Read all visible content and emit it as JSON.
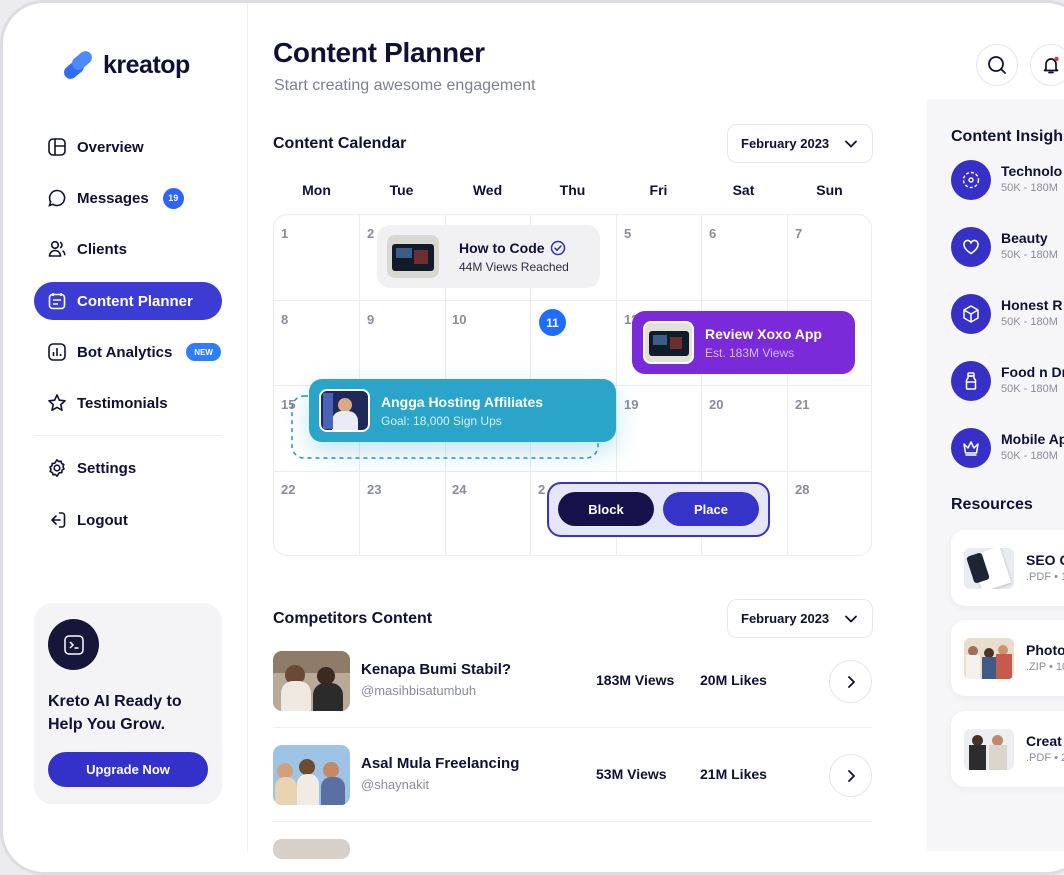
{
  "brand": {
    "name": "kreatop"
  },
  "sidebar": {
    "items": [
      {
        "label": "Overview",
        "icon": "layout-icon"
      },
      {
        "label": "Messages",
        "icon": "chat-icon",
        "badge": "19"
      },
      {
        "label": "Clients",
        "icon": "users-icon"
      },
      {
        "label": "Content Planner",
        "icon": "calendar-icon",
        "active": true
      },
      {
        "label": "Bot Analytics",
        "icon": "chart-icon",
        "badge": "NEW"
      },
      {
        "label": "Testimonials",
        "icon": "star-icon"
      },
      {
        "label": "Settings",
        "icon": "gear-icon"
      },
      {
        "label": "Logout",
        "icon": "logout-icon"
      }
    ],
    "promo": {
      "title": "Kreto AI Ready to Help You Grow.",
      "button": "Upgrade Now"
    }
  },
  "header": {
    "title": "Content Planner",
    "subtitle": "Start creating awesome engagement"
  },
  "calendar": {
    "title": "Content Calendar",
    "month": "February 2023",
    "days_of_week": [
      "Mon",
      "Tue",
      "Wed",
      "Thu",
      "Fri",
      "Sat",
      "Sun"
    ],
    "dates": [
      "1",
      "2",
      "",
      "",
      "5",
      "6",
      "7",
      "8",
      "9",
      "10",
      "11",
      "12",
      "",
      "",
      "15",
      "",
      "",
      "",
      "19",
      "20",
      "21",
      "22",
      "23",
      "24",
      "2",
      "",
      "28"
    ],
    "today": "11",
    "events": {
      "how_to_code": {
        "title": "How to Code",
        "subtitle": "44M Views Reached",
        "verified": true
      },
      "review_xoxo": {
        "title": "Review Xoxo App",
        "subtitle": "Est. 183M Views"
      },
      "angga": {
        "title": "Angga Hosting Affiliates",
        "subtitle": "Goal: 18,000 Sign Ups"
      }
    },
    "actions": {
      "block": "Block",
      "place": "Place"
    }
  },
  "competitors": {
    "title": "Competitors Content",
    "month": "February 2023",
    "rows": [
      {
        "title": "Kenapa Bumi Stabil?",
        "handle": "@masihbisatumbuh",
        "views": "183M Views",
        "likes": "20M Likes"
      },
      {
        "title": "Asal Mula Freelancing",
        "handle": "@shaynakit",
        "views": "53M Views",
        "likes": "21M Likes"
      }
    ]
  },
  "insights": {
    "title": "Content Insigh",
    "items": [
      {
        "name": "Technolo",
        "range": "50K - 180M",
        "icon": "atom-icon"
      },
      {
        "name": "Beauty",
        "range": "50K - 180M",
        "icon": "heart-icon"
      },
      {
        "name": "Honest R",
        "range": "50K - 180M",
        "icon": "box-icon"
      },
      {
        "name": "Food n Dr",
        "range": "50K - 180M",
        "icon": "bottle-icon"
      },
      {
        "name": "Mobile Ap",
        "range": "50K - 180M",
        "icon": "crown-icon"
      }
    ]
  },
  "resources": {
    "title": "Resources",
    "items": [
      {
        "name": "SEO C",
        "meta": ".PDF • 1"
      },
      {
        "name": "Photo",
        "meta": ".ZIP • 10"
      },
      {
        "name": "Creat",
        "meta": ".PDF • 2"
      }
    ]
  },
  "colors": {
    "primary": "#3b3cd4",
    "purple_event": "#7b2ad9",
    "teal_event": "#2aa5c9",
    "today": "#1f6dff"
  }
}
